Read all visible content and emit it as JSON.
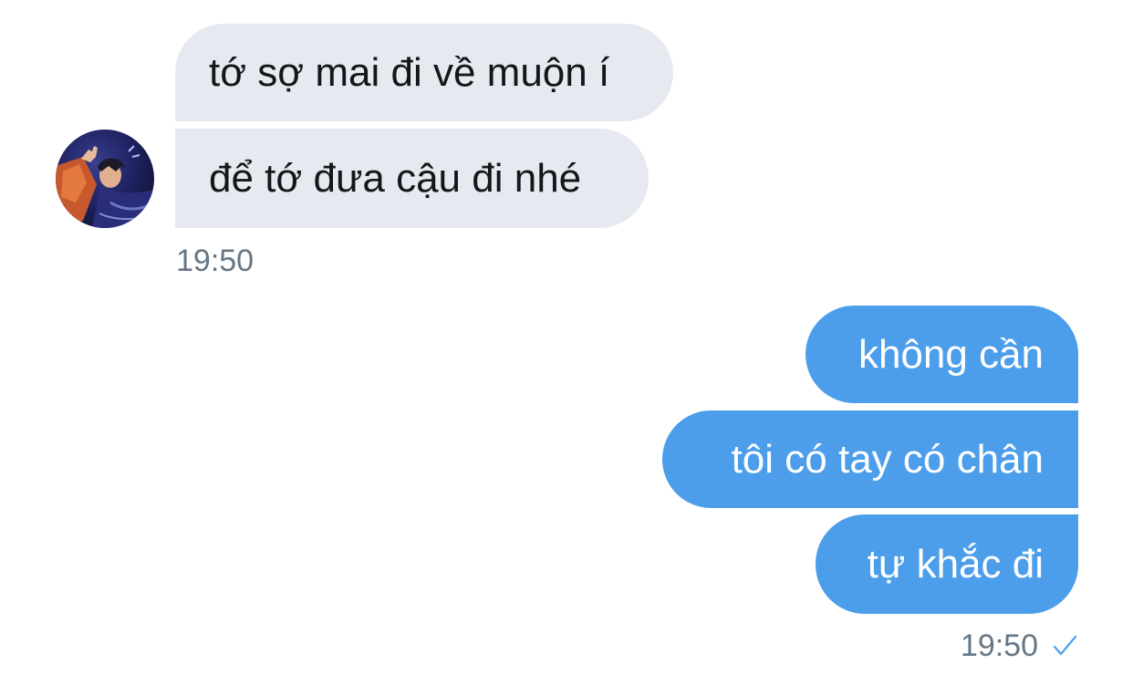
{
  "conversation": {
    "incoming": {
      "messages": [
        "tớ sợ mai đi về muộn í",
        "để tớ đưa cậu đi nhé"
      ],
      "timestamp": "19:50",
      "avatar_icon": "profile-photo"
    },
    "outgoing": {
      "messages": [
        "không cần",
        "tôi có tay có chân",
        "tự khắc đi"
      ],
      "timestamp": "19:50",
      "status_icon": "checkmark-icon"
    }
  },
  "colors": {
    "incoming_bubble": "#e6e9ef",
    "outgoing_bubble": "#4c9eeb",
    "timestamp_text": "#657786",
    "checkmark": "#4c9eeb"
  }
}
